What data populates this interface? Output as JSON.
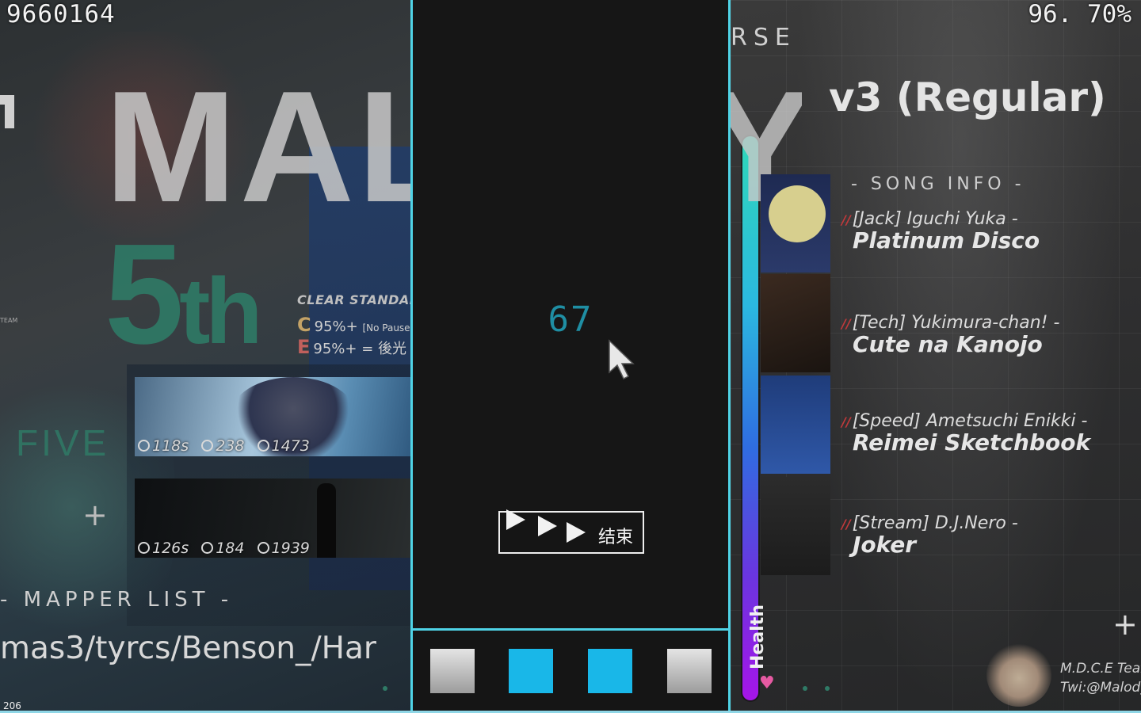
{
  "hud": {
    "score": "9660164",
    "accuracy": "96. 70%",
    "combo": "67"
  },
  "left": {
    "big_title": "MAL",
    "ordinal": "5",
    "ordinal_suffix": "th",
    "team_tiny": "TEAM",
    "clear_standard": {
      "heading": "CLEAR STANDARD",
      "rows": [
        {
          "letter": "C",
          "text": "95%+",
          "note": "[No Pause"
        },
        {
          "letter": "E",
          "text": "95%+ = 後光",
          "note": ""
        }
      ]
    },
    "five_label": "FIVE",
    "plus": "+",
    "songs": [
      {
        "time": "118s",
        "notes": "238",
        "combo": "1473"
      },
      {
        "time": "126s",
        "notes": "184",
        "combo": "1939"
      }
    ],
    "mapper_heading": "- MAPPER LIST -",
    "mapper_list": "mas3/tyrcs/Benson_/Har",
    "tiny_number": "206"
  },
  "center": {
    "skip_label": "结束",
    "keys": [
      {
        "color": "gray"
      },
      {
        "color": "blue"
      },
      {
        "color": "blue"
      },
      {
        "color": "gray"
      }
    ]
  },
  "health": {
    "label": "Health",
    "level": 1.0,
    "color_top": "#2fd8b9",
    "color_bottom": "#a515e8"
  },
  "right": {
    "course_partial": "RSE",
    "y_partial": "Y",
    "difficulty_title": "v3 (Regular)",
    "song_info_heading": "- SONG INFO -",
    "songs": [
      {
        "category": "[Jack] Iguchi Yuka -",
        "title": "Platinum Disco"
      },
      {
        "category": "[Tech] Yukimura-chan! -",
        "title": "Cute na Kanojo"
      },
      {
        "category": "[Speed] Ametsuchi Enikki -",
        "title": "Reimei Sketchbook"
      },
      {
        "category": "[Stream] D.J.Nero -",
        "title": "Joker"
      }
    ],
    "plus": "+",
    "credit_team": "M.D.C.E Team",
    "credit_twitter": "Twi:@Malody"
  },
  "colors": {
    "accent_cyan": "#4fd3e6",
    "key_blue": "#19b7e8",
    "combo_teal": "#1f8ea3",
    "fifth_green": "#2f7a66",
    "mark_red": "#c0393b"
  },
  "icons": {
    "time": "clock-icon",
    "notes": "triangle-circle-icon",
    "combo": "combo-circle-icon",
    "cursor": "mouse-pointer-icon",
    "skip": "fast-forward-icon",
    "heart": "heart-icon"
  }
}
